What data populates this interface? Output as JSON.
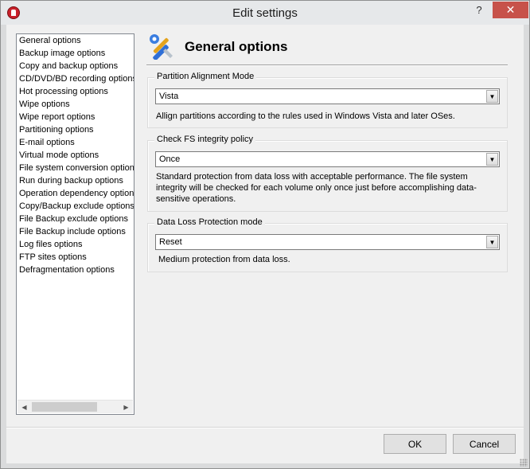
{
  "window": {
    "title": "Edit settings",
    "help_label": "?",
    "close_label": "✕"
  },
  "sidebar": {
    "items": [
      "General options",
      "Backup image options",
      "Copy and backup options",
      "CD/DVD/BD recording options",
      "Hot processing options",
      "Wipe options",
      "Wipe report options",
      "Partitioning options",
      "E-mail options",
      "Virtual mode options",
      "File system conversion options",
      "Run during backup options",
      "Operation dependency options",
      "Copy/Backup exclude options",
      "File Backup exclude options",
      "File Backup include options",
      "Log files options",
      "FTP sites options",
      "Defragmentation options"
    ],
    "selected_index": 0
  },
  "header": {
    "title": "General options",
    "icon": "tools-icon"
  },
  "groups": [
    {
      "legend": "Partition Alignment Mode",
      "value": "Vista",
      "description": "Allign partitions according to the rules used in Windows Vista and later OSes."
    },
    {
      "legend": "Check FS integrity policy",
      "value": "Once",
      "description": "Standard protection from data loss with acceptable performance. The file system integrity will be checked for each volume only once just before accomplishing data-sensitive operations."
    },
    {
      "legend": "Data Loss Protection mode",
      "value": "Reset",
      "description": "Medium protection from data loss."
    }
  ],
  "buttons": {
    "ok": "OK",
    "cancel": "Cancel"
  },
  "colors": {
    "accent": "#c7524a",
    "selection": "#ffffff"
  }
}
